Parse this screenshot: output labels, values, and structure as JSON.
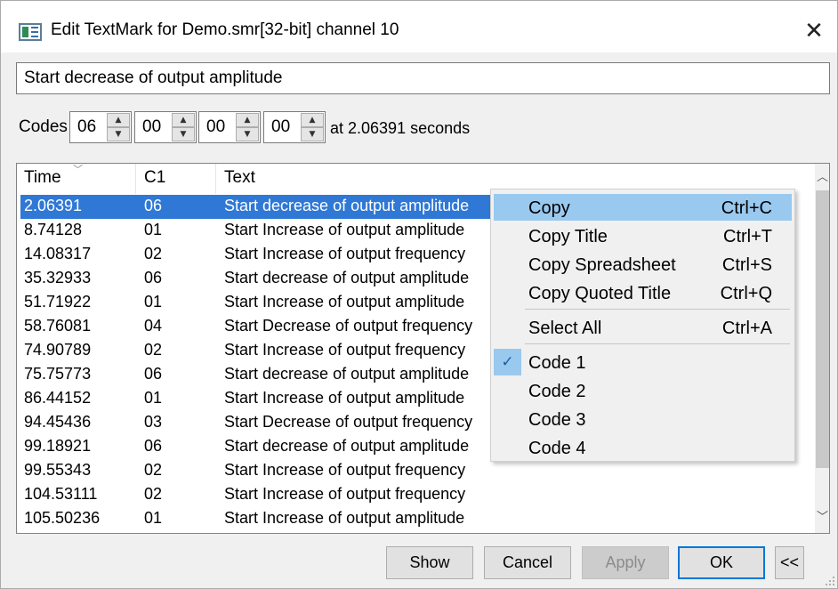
{
  "window": {
    "title": "Edit TextMark for Demo.smr[32-bit] channel 10",
    "close_glyph": "✕"
  },
  "text_field": {
    "value": "Start decrease of output amplitude"
  },
  "codes": {
    "label": "Codes",
    "values": [
      "06",
      "00",
      "00",
      "00"
    ],
    "at_text": "at  2.06391 seconds"
  },
  "table": {
    "columns": [
      "Time",
      "C1",
      "Text"
    ],
    "selected_index": 0,
    "rows": [
      {
        "time": "2.06391",
        "c1": "06",
        "text": "Start decrease of output amplitude"
      },
      {
        "time": "8.74128",
        "c1": "01",
        "text": "Start Increase of output amplitude"
      },
      {
        "time": "14.08317",
        "c1": "02",
        "text": "Start Increase of output frequency"
      },
      {
        "time": "35.32933",
        "c1": "06",
        "text": "Start decrease of output amplitude"
      },
      {
        "time": "51.71922",
        "c1": "01",
        "text": "Start Increase of output amplitude"
      },
      {
        "time": "58.76081",
        "c1": "04",
        "text": "Start Decrease of output frequency"
      },
      {
        "time": "74.90789",
        "c1": "02",
        "text": "Start Increase of output frequency"
      },
      {
        "time": "75.75773",
        "c1": "06",
        "text": "Start decrease of output amplitude"
      },
      {
        "time": "86.44152",
        "c1": "01",
        "text": "Start Increase of output amplitude"
      },
      {
        "time": "94.45436",
        "c1": "03",
        "text": "Start Decrease of output frequency"
      },
      {
        "time": "99.18921",
        "c1": "06",
        "text": "Start decrease of output amplitude"
      },
      {
        "time": "99.55343",
        "c1": "02",
        "text": "Start Increase of output frequency"
      },
      {
        "time": "104.53111",
        "c1": "02",
        "text": "Start Increase of output frequency"
      },
      {
        "time": "105.50236",
        "c1": "01",
        "text": "Start Increase of output amplitude"
      }
    ]
  },
  "context_menu": {
    "items": [
      {
        "label": "Copy",
        "shortcut": "Ctrl+C"
      },
      {
        "label": "Copy Title",
        "shortcut": "Ctrl+T"
      },
      {
        "label": "Copy Spreadsheet",
        "shortcut": "Ctrl+S"
      },
      {
        "label": "Copy Quoted Title",
        "shortcut": "Ctrl+Q"
      },
      {
        "label": "Select All",
        "shortcut": "Ctrl+A"
      },
      {
        "label": "Code 1",
        "checked": true
      },
      {
        "label": "Code 2"
      },
      {
        "label": "Code 3"
      },
      {
        "label": "Code 4"
      }
    ],
    "check_glyph": "✓"
  },
  "buttons": {
    "show": "Show",
    "cancel": "Cancel",
    "apply": "Apply",
    "ok": "OK",
    "collapse": "<<"
  },
  "colors": {
    "selection": "#2f78d6",
    "menu_highlight": "#99c9ef",
    "default_button_border": "#0078d7"
  }
}
